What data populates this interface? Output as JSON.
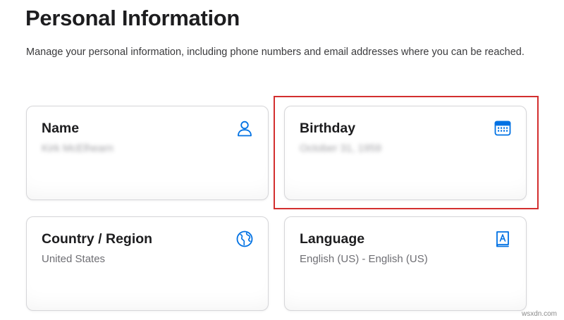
{
  "header": {
    "title": "Personal Information",
    "description": "Manage your personal information, including phone numbers and email addresses where you can be reached."
  },
  "cards": [
    {
      "title": "Name",
      "value": "Kirk McElhearn",
      "icon": "person-icon",
      "value_blurred": true
    },
    {
      "title": "Birthday",
      "value": "October 31, 1959",
      "icon": "calendar-icon",
      "value_blurred": true,
      "highlighted": true
    },
    {
      "title": "Country / Region",
      "value": "United States",
      "icon": "globe-icon",
      "value_blurred": false
    },
    {
      "title": "Language",
      "value": "English (US) - English (US)",
      "icon": "dictionary-icon",
      "value_blurred": false
    }
  ],
  "colors": {
    "accent": "#0071e3",
    "highlight": "#d32f2f",
    "title_text": "#1d1d1f",
    "secondary_text": "#6e6e73"
  },
  "watermark": "wsxdn.com"
}
